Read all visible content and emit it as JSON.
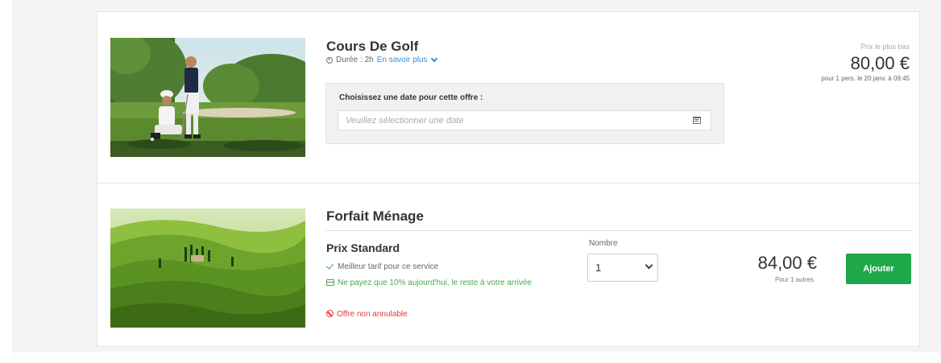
{
  "offers": {
    "golf": {
      "title": "Cours De Golf",
      "duration": "Durée : 2h",
      "more_link": "En savoir plus",
      "date_prompt": "Choisissez une date pour cette offre :",
      "date_placeholder": "Veuillez sélectionner une date",
      "price_label": "Prix le plus bas",
      "price": "80,00 €",
      "price_note": "pour 1 pers. le 20 janv. à 09:45"
    },
    "menage": {
      "title": "Forfait Ménage",
      "rate_title": "Prix Standard",
      "features": [
        "Meilleur tarif pour ce service",
        "Ne payez que 10% aujourd'hui, le reste à votre arrivée",
        "Offre non annulable"
      ],
      "quantity_label": "Nombre",
      "quantity_value": "1",
      "price": "84,00 €",
      "price_note": "Pour 1 autres",
      "add_label": "Ajouter"
    }
  },
  "colors": {
    "link": "#3a8ad6",
    "success": "#4aa84a",
    "danger": "#e23a3a",
    "button": "#1ea84a"
  },
  "icons": [
    "clock-icon",
    "chevron-down-icon",
    "calendar-icon",
    "check-icon",
    "card-icon",
    "ban-icon"
  ]
}
